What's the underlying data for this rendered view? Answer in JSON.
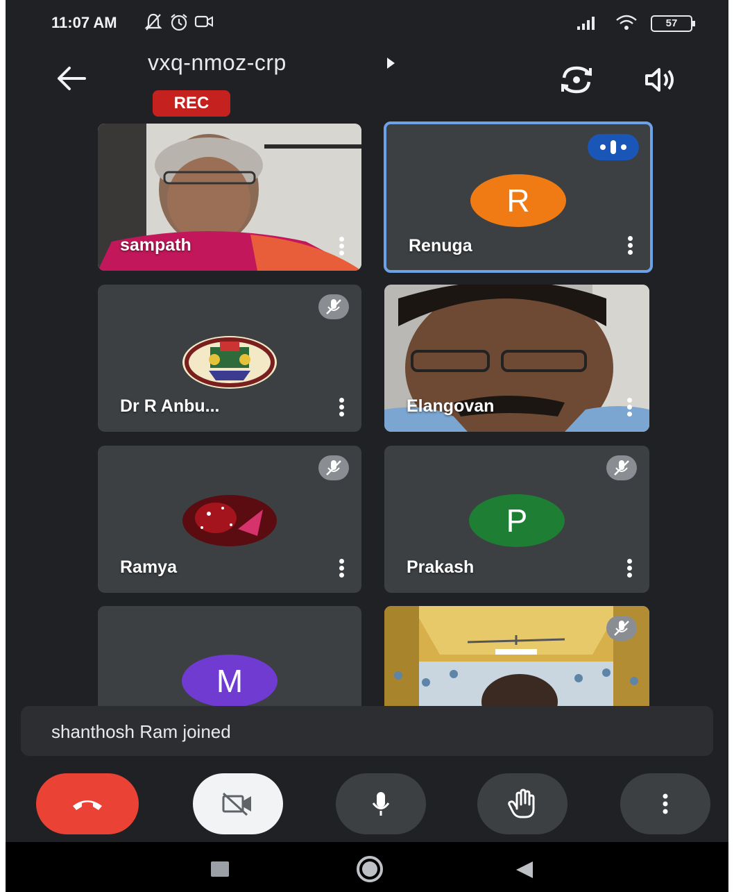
{
  "status_bar": {
    "time": "11:07 AM",
    "battery": "57",
    "icons": [
      "mute-notifications-icon",
      "alarm-icon",
      "video-record-icon",
      "signal-icon",
      "wifi-icon",
      "battery-icon"
    ]
  },
  "header": {
    "meeting_code": "vxq-nmoz-crp",
    "rec_label": "REC",
    "icons": [
      "back-arrow-icon",
      "caret-right-icon",
      "switch-camera-icon",
      "speaker-icon"
    ]
  },
  "participants": [
    {
      "name": "sampath",
      "type": "video"
    },
    {
      "name": "Renuga",
      "type": "avatar",
      "initial": "R",
      "avatar_color": "#f07b14",
      "speaking": true
    },
    {
      "name": "Dr R Anbu...",
      "type": "logo",
      "muted": true
    },
    {
      "name": "Elangovan",
      "type": "video"
    },
    {
      "name": "Ramya",
      "type": "photo-avatar",
      "muted": true
    },
    {
      "name": "Prakash",
      "type": "avatar",
      "initial": "P",
      "avatar_color": "#1e7e34",
      "muted": true
    },
    {
      "name": "",
      "type": "avatar",
      "initial": "M",
      "avatar_color": "#6f3bd1"
    },
    {
      "name": "",
      "type": "video",
      "muted": true
    }
  ],
  "notification": {
    "text": "shanthosh Ram joined"
  },
  "controls": {
    "icons": [
      "end-call-icon",
      "camera-off-icon",
      "microphone-icon",
      "raise-hand-icon",
      "more-options-icon"
    ]
  },
  "nav_bar": {
    "icons": [
      "recents-icon",
      "home-icon",
      "back-icon"
    ]
  },
  "colors": {
    "background": "#202124",
    "tile": "#3c4043",
    "rec": "#c5221f",
    "end_call": "#ea4335",
    "active_speaker_border": "#6ea2e8"
  }
}
